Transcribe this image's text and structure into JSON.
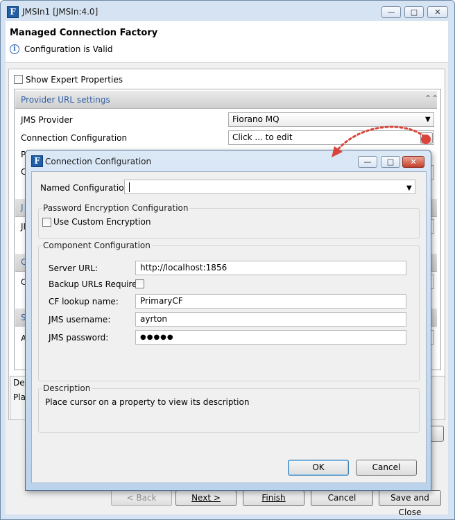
{
  "outer_window": {
    "title": "JMSIn1 [JMSIn:4.0]",
    "app_icon": "F",
    "controls": {
      "minimize": "—",
      "maximize": "□",
      "close": "✕"
    },
    "heading": "Managed Connection Factory",
    "status_icon": "info-icon",
    "status_glyph": "i",
    "status_text": "Configuration is Valid",
    "show_expert_label": "Show Expert Properties",
    "show_expert_checked": false,
    "section_provider": {
      "title": "Provider URL settings",
      "collapse_glyph": "⌃⌃",
      "rows": [
        {
          "label": "JMS Provider",
          "value": "Fiorano MQ"
        },
        {
          "label": "Connection Configuration",
          "value": "Click ... to edit"
        }
      ]
    },
    "partial_labels": {
      "p": "P",
      "c1": "C",
      "j1": "J",
      "j2": "JI",
      "c2": "C",
      "c3": "C",
      "s": "S",
      "a": "A"
    },
    "description_partial": {
      "line1": "Des",
      "line2": "Pla"
    },
    "wizard_buttons": {
      "back": "< Back",
      "next": "Next >",
      "finish": "Finish",
      "cancel": "Cancel",
      "save_close": "Save and Close"
    }
  },
  "dialog": {
    "title": "Connection Configuration",
    "app_icon": "F",
    "controls": {
      "minimize": "—",
      "maximize": "□",
      "close": "✕"
    },
    "named_config_label": "Named Configuration",
    "named_config_value": "",
    "password_group": {
      "title": "Password Encryption Configuration",
      "use_custom_label": "Use Custom Encryption",
      "use_custom_checked": false
    },
    "component_group": {
      "title": "Component Configuration",
      "fields": {
        "server_url": {
          "label": "Server URL:",
          "value": "http://localhost:1856"
        },
        "backup_urls": {
          "label": "Backup URLs Required",
          "checked": false
        },
        "cf_lookup": {
          "label": "CF lookup name:",
          "value": "PrimaryCF"
        },
        "jms_username": {
          "label": "JMS username:",
          "value": "ayrton"
        },
        "jms_password": {
          "label": "JMS password:",
          "value": "●●●●●"
        }
      }
    },
    "description_group": {
      "title": "Description",
      "text": "Place cursor on a property to view its description"
    },
    "buttons": {
      "ok": "OK",
      "cancel": "Cancel"
    }
  },
  "colors": {
    "annotation_arrow": "#d9443a",
    "section_title": "#2f5fa8",
    "title_bar": "#c7dbef"
  }
}
